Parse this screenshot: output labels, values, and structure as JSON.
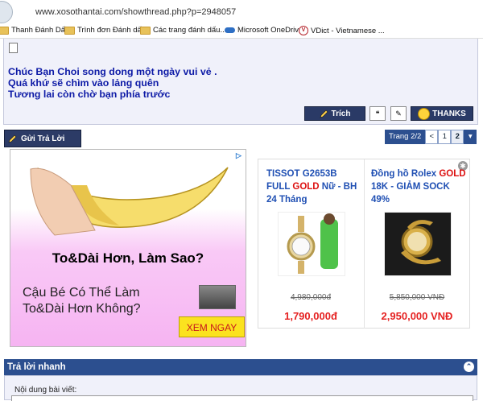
{
  "browser": {
    "url": "www.xosothantai.com/showthread.php?p=2948057",
    "bookmarks": [
      {
        "label": "Thanh Đánh Dấu",
        "icon": "folder-icon"
      },
      {
        "label": "Trình đơn Đánh dấu",
        "icon": "folder-icon"
      },
      {
        "label": "Các trang đánh dấu...",
        "icon": "folder-icon"
      },
      {
        "label": "Microsoft OneDrive",
        "icon": "cloud-icon"
      },
      {
        "label": "VDict - Vietnamese ...",
        "icon": "vdict-icon"
      }
    ]
  },
  "post": {
    "signature": [
      "Chúc Bạn Choi song dong một ngày vui vẻ .",
      "Quá khứ sẽ chìm vào lảng quên",
      "Tương lai còn chờ bạn phía trước"
    ],
    "quote_label": "Trích",
    "thanks_label": "THANKS"
  },
  "thread": {
    "reply_label": "Gửi Trả Lời",
    "pager": {
      "label": "Trang 2/2",
      "prev": "<",
      "pages": [
        "1",
        "2"
      ],
      "current": "2"
    }
  },
  "ad_left": {
    "headline": "To&Dài Hơn, Làm Sao?",
    "subtext": "Cậu Bé Có Thể Làm To&Dài Hơn Không?",
    "cta": "XEM NGAY"
  },
  "ad_right": {
    "products": [
      {
        "title_a": "TISSOT G2653B FULL ",
        "title_gold": "GOLD",
        "title_b": " Nữ - BH 24 Tháng",
        "old_price": "4,980,000đ",
        "new_price": "1,790,000đ"
      },
      {
        "title_a": "Đồng hồ Rolex ",
        "title_gold": "GOLD",
        "title_b": " 18K - GIẢM SOCK 49%",
        "old_price": "5,850,000 VNĐ",
        "new_price": "2,950,000 VNĐ"
      }
    ]
  },
  "quick_reply": {
    "title": "Trả lời nhanh",
    "label": "Nội dung bài viết:"
  }
}
